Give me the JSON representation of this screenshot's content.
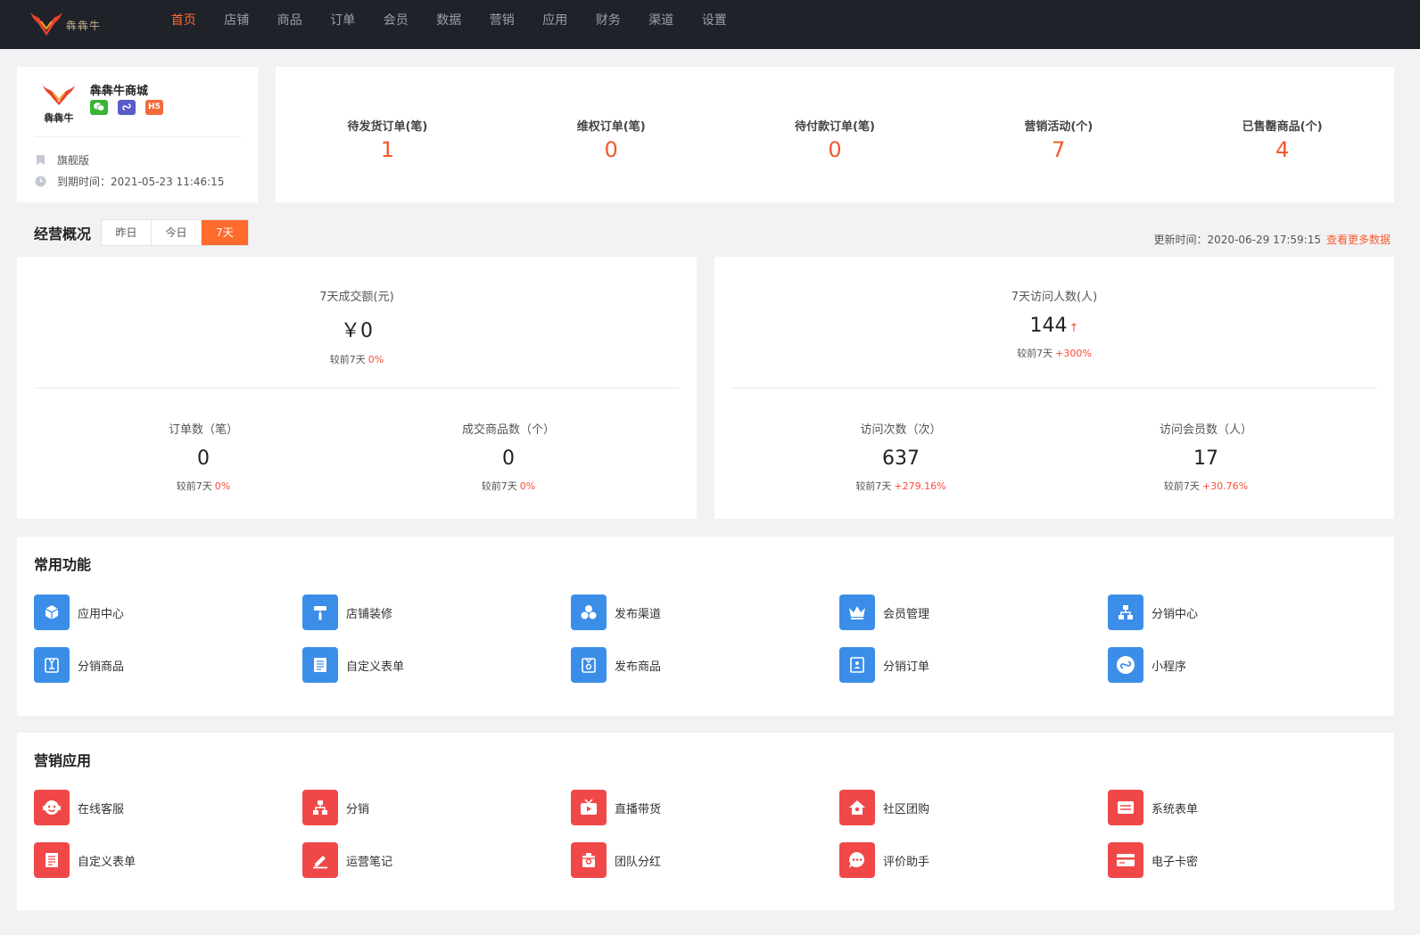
{
  "brand": {
    "logo_text": "犇犇牛",
    "accent": "#ff6a2d"
  },
  "nav": [
    "首页",
    "店铺",
    "商品",
    "订单",
    "会员",
    "数据",
    "营销",
    "应用",
    "财务",
    "渠道",
    "设置"
  ],
  "shop": {
    "logo_text": "犇犇牛",
    "name": "犇犇牛商城",
    "badges": [
      "wechat-icon",
      "mini-program-icon",
      "H5"
    ],
    "edition": "旗舰版",
    "expire": "到期时间：2021-05-23 11:46:15"
  },
  "stats": [
    {
      "label": "待发货订单(笔)",
      "value": "1"
    },
    {
      "label": "维权订单(笔)",
      "value": "0"
    },
    {
      "label": "待付款订单(笔)",
      "value": "0"
    },
    {
      "label": "营销活动(个)",
      "value": "7"
    },
    {
      "label": "已售罄商品(个)",
      "value": "4"
    }
  ],
  "overview": {
    "title": "经营概况",
    "tabs": [
      "昨日",
      "今日",
      "7天"
    ],
    "active_tab": "7天",
    "update_time": "更新时间：2020-06-29 17:59:15",
    "more_link": "查看更多数据",
    "compare_prefix": "较前7天",
    "left": {
      "main": {
        "label": "7天成交额(元)",
        "value": "￥0",
        "pct": "0%"
      },
      "subs": [
        {
          "label": "订单数（笔）",
          "value": "0",
          "pct": "0%"
        },
        {
          "label": "成交商品数（个）",
          "value": "0",
          "pct": "0%"
        }
      ]
    },
    "right": {
      "main": {
        "label": "7天访问人数(人)",
        "value": "144",
        "arrow": "↑",
        "pct": "+300%"
      },
      "subs": [
        {
          "label": "访问次数（次）",
          "value": "637",
          "pct": "+279.16%"
        },
        {
          "label": "访问会员数（人）",
          "value": "17",
          "pct": "+30.76%"
        }
      ]
    }
  },
  "common": {
    "title": "常用功能",
    "items": [
      {
        "label": "应用中心",
        "icon": "cube-icon"
      },
      {
        "label": "店铺装修",
        "icon": "paint-roller-icon"
      },
      {
        "label": "发布渠道",
        "icon": "hexagons-icon"
      },
      {
        "label": "会员管理",
        "icon": "crown-icon"
      },
      {
        "label": "分销中心",
        "icon": "org-chart-icon"
      },
      {
        "label": "分销商品",
        "icon": "bag-icon"
      },
      {
        "label": "自定义表单",
        "icon": "form-icon"
      },
      {
        "label": "发布商品",
        "icon": "product-icon"
      },
      {
        "label": "分销订单",
        "icon": "order-icon"
      },
      {
        "label": "小程序",
        "icon": "mini-program-icon"
      }
    ]
  },
  "marketing": {
    "title": "营销应用",
    "items": [
      {
        "label": "在线客服",
        "icon": "headset-icon"
      },
      {
        "label": "分销",
        "icon": "org-chart-icon"
      },
      {
        "label": "直播带货",
        "icon": "tv-icon"
      },
      {
        "label": "社区团购",
        "icon": "house-icon"
      },
      {
        "label": "系统表单",
        "icon": "card-icon"
      },
      {
        "label": "自定义表单",
        "icon": "form-icon"
      },
      {
        "label": "运营笔记",
        "icon": "pen-icon"
      },
      {
        "label": "团队分红",
        "icon": "bag-icon"
      },
      {
        "label": "评价助手",
        "icon": "chat-icon"
      },
      {
        "label": "电子卡密",
        "icon": "credit-card-icon"
      }
    ]
  }
}
